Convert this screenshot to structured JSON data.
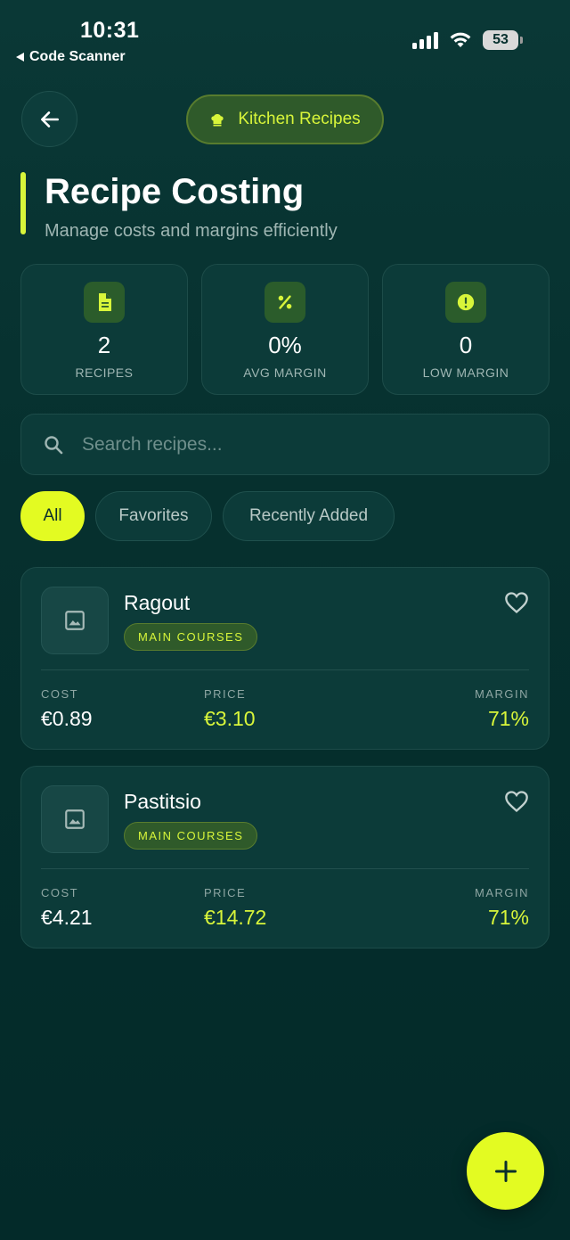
{
  "status_bar": {
    "time": "10:31",
    "back_app": "Code Scanner",
    "battery": "53"
  },
  "header": {
    "badge_label": "Kitchen Recipes",
    "title": "Recipe Costing",
    "subtitle": "Manage costs and margins efficiently"
  },
  "stats": [
    {
      "value": "2",
      "label": "RECIPES",
      "icon": "document-icon"
    },
    {
      "value": "0%",
      "label": "AVG MARGIN",
      "icon": "percent-icon"
    },
    {
      "value": "0",
      "label": "LOW MARGIN",
      "icon": "alert-icon"
    }
  ],
  "search": {
    "placeholder": "Search recipes...",
    "value": ""
  },
  "filters": [
    "All",
    "Favorites",
    "Recently Added"
  ],
  "active_filter": "All",
  "recipes": [
    {
      "name": "Ragout",
      "category": "MAIN COURSES",
      "cost_label": "COST",
      "cost": "€0.89",
      "price_label": "PRICE",
      "price": "€3.10",
      "margin_label": "MARGIN",
      "margin": "71%"
    },
    {
      "name": "Pastitsio",
      "category": "MAIN COURSES",
      "cost_label": "COST",
      "cost": "€4.21",
      "price_label": "PRICE",
      "price": "€14.72",
      "margin_label": "MARGIN",
      "margin": "71%"
    }
  ],
  "colors": {
    "accent": "#e3fb22",
    "background": "#06312f",
    "card": "#0c3b39"
  }
}
